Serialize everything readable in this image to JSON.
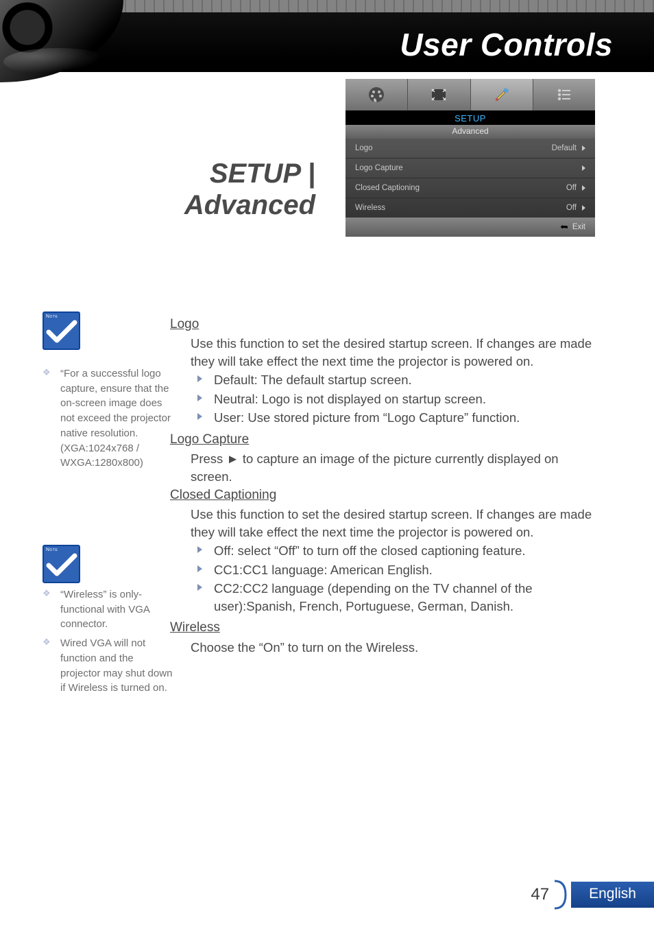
{
  "page_title": "User Controls",
  "section_title_line1": "SETUP |",
  "section_title_line2": "Advanced",
  "osd": {
    "menu_name": "SETUP",
    "submenu": "Advanced",
    "rows": [
      {
        "label": "Logo",
        "value": "Default"
      },
      {
        "label": "Logo Capture",
        "value": ""
      },
      {
        "label": "Closed Captioning",
        "value": "Off"
      },
      {
        "label": "Wireless",
        "value": "Off"
      }
    ],
    "exit": "Exit"
  },
  "notes": {
    "label": "Note",
    "n1": "“For a successful logo capture, ensure that the on-screen image does not exceed the projector native resolution.(XGA:1024x768 / WXGA:1280x800)",
    "n2a": "“Wireless” is only-functional with VGA connector.",
    "n2b": "Wired VGA will not function and the projector may shut down if Wireless is turned on."
  },
  "sections": {
    "logo": {
      "h": "Logo",
      "p": "Use this function to set the desired startup screen. If changes are made they will take effect the next time the projector is powered on.",
      "items": [
        "Default: The default startup screen.",
        "Neutral: Logo is not displayed on startup screen.",
        "User: Use stored picture from “Logo Capture” function."
      ]
    },
    "logo_capture": {
      "h": "Logo Capture",
      "p": "Press ► to capture an image of the picture currently displayed on screen."
    },
    "cc": {
      "h": "Closed Captioning",
      "p": "Use this function to set the desired startup screen. If changes are made they will take effect the next time the projector is powered on.",
      "items": [
        "Off: select “Off” to turn off the closed captioning feature.",
        "CC1:CC1 language: American English.",
        "CC2:CC2 language (depending on the TV channel of the user):Spanish, French, Portuguese, German, Danish."
      ]
    },
    "wireless": {
      "h": "Wireless",
      "p": "Choose the “On” to turn on the Wireless."
    }
  },
  "footer": {
    "page": "47",
    "language": "English"
  }
}
